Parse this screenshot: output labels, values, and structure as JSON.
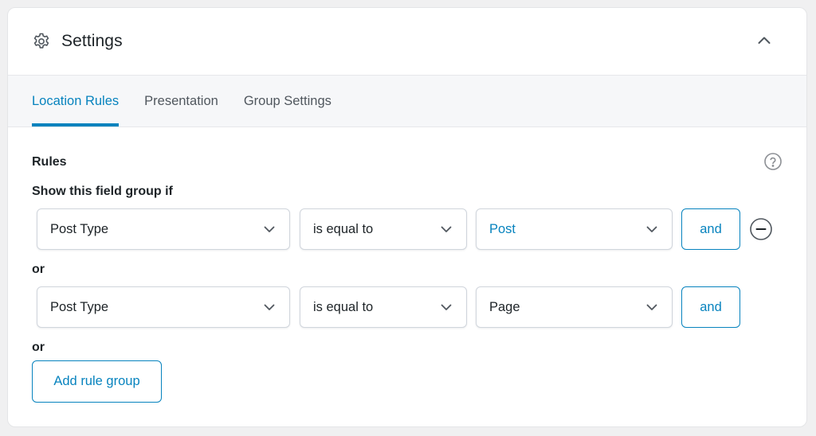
{
  "header": {
    "title": "Settings",
    "icon": "gear-icon",
    "collapse_icon": "chevron-up-icon"
  },
  "tabs": [
    {
      "label": "Location Rules",
      "active": true
    },
    {
      "label": "Presentation",
      "active": false
    },
    {
      "label": "Group Settings",
      "active": false
    }
  ],
  "rules": {
    "label": "Rules",
    "help_icon": "question-icon",
    "show_label": "Show this field group if",
    "or_label": "or",
    "groups": [
      {
        "param": "Post Type",
        "operator": "is equal to",
        "value": "Post",
        "and_label": "and",
        "removable": true
      },
      {
        "param": "Post Type",
        "operator": "is equal to",
        "value": "Page",
        "and_label": "and",
        "removable": false
      }
    ],
    "add_group_label": "Add rule group"
  },
  "colors": {
    "accent": "#0783be",
    "text": "#1d2327",
    "muted": "#50575e",
    "tab_bar_bg": "#f6f7f9",
    "page_bg": "#f0f0f1"
  }
}
